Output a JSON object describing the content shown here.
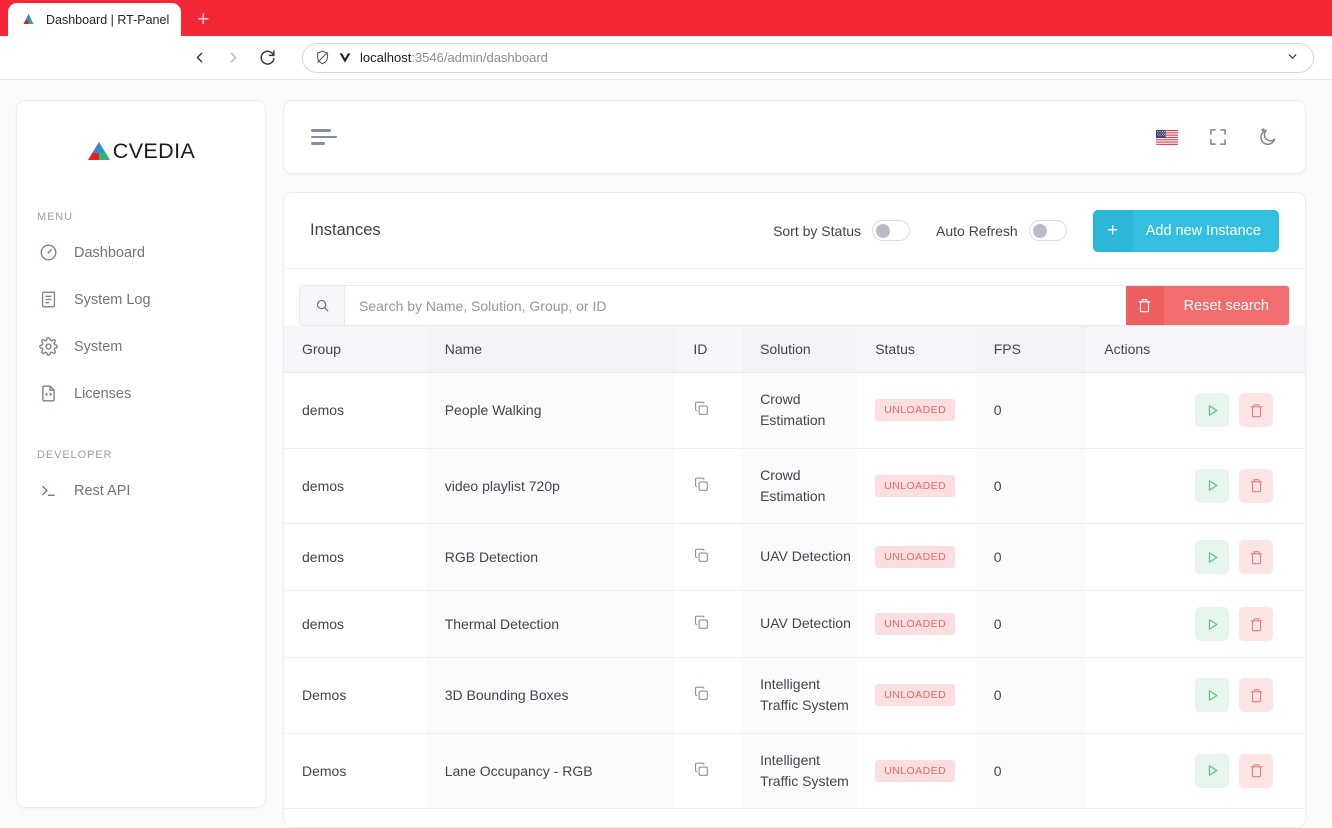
{
  "browser": {
    "tab_title": "Dashboard | RT-Panel",
    "newtab_label": "+",
    "url_host": "localhost",
    "url_path": ":3546/admin/dashboard",
    "back_icon": "back-arrow-icon",
    "forward_icon": "forward-arrow-icon",
    "reload_icon": "reload-icon",
    "shield_icon": "shield-off-icon",
    "vpn_icon": "v-shield-icon",
    "caret_icon": "chevron-down-icon"
  },
  "sidebar": {
    "logo_text": "CVEDIA",
    "sections": [
      {
        "label": "MENU",
        "items": [
          {
            "label": "Dashboard",
            "icon": "gauge-icon"
          },
          {
            "label": "System Log",
            "icon": "document-lines-icon"
          },
          {
            "label": "System",
            "icon": "gear-icon"
          },
          {
            "label": "Licenses",
            "icon": "file-code-icon"
          }
        ]
      },
      {
        "label": "DEVELOPER",
        "items": [
          {
            "label": "Rest API",
            "icon": "terminal-prompt-icon"
          }
        ]
      }
    ]
  },
  "topbar": {
    "menu_icon": "hamburger-menu-icon",
    "language_icon": "us-flag-icon",
    "fullscreen_icon": "fullscreen-icon",
    "theme_icon": "dark-mode-moon-icon"
  },
  "panel": {
    "title": "Instances",
    "sort_by_status": {
      "label": "Sort by Status",
      "checked": false
    },
    "auto_refresh": {
      "label": "Auto Refresh",
      "checked": false
    },
    "add_button": {
      "plus": "+",
      "label": "Add new Instance"
    },
    "search": {
      "placeholder": "Search by Name, Solution, Group, or ID",
      "value": "",
      "icon": "search-icon",
      "reset_label": "Reset search",
      "reset_icon": "trash-icon"
    },
    "table": {
      "columns": [
        "Group",
        "Name",
        "ID",
        "Solution",
        "Status",
        "FPS",
        "Actions"
      ],
      "rows": [
        {
          "group": "demos",
          "name": "People Walking",
          "id_icon": "copy-icon",
          "solution": "Crowd Estimation",
          "status": "UNLOADED",
          "fps": "0"
        },
        {
          "group": "demos",
          "name": "video playlist 720p",
          "id_icon": "copy-icon",
          "solution": "Crowd Estimation",
          "status": "UNLOADED",
          "fps": "0"
        },
        {
          "group": "demos",
          "name": "RGB Detection",
          "id_icon": "copy-icon",
          "solution": "UAV Detection",
          "status": "UNLOADED",
          "fps": "0"
        },
        {
          "group": "demos",
          "name": "Thermal Detection",
          "id_icon": "copy-icon",
          "solution": "UAV Detection",
          "status": "UNLOADED",
          "fps": "0"
        },
        {
          "group": "Demos",
          "name": "3D Bounding Boxes",
          "id_icon": "copy-icon",
          "solution": "Intelligent Traffic System",
          "status": "UNLOADED",
          "fps": "0"
        },
        {
          "group": "Demos",
          "name": "Lane Occupancy - RGB",
          "id_icon": "copy-icon",
          "solution": "Intelligent Traffic System",
          "status": "UNLOADED",
          "fps": "0"
        }
      ],
      "row_actions": {
        "play_icon": "play-icon",
        "delete_icon": "trash-icon"
      }
    }
  },
  "colors": {
    "browser_accent": "#f32735",
    "primary": "#33c0e0",
    "danger": "#f26d6d",
    "status_badge_bg": "#fbdedf",
    "status_badge_text": "#e8696c",
    "play_bg": "#e6f6ec",
    "play_fg": "#63c281"
  }
}
